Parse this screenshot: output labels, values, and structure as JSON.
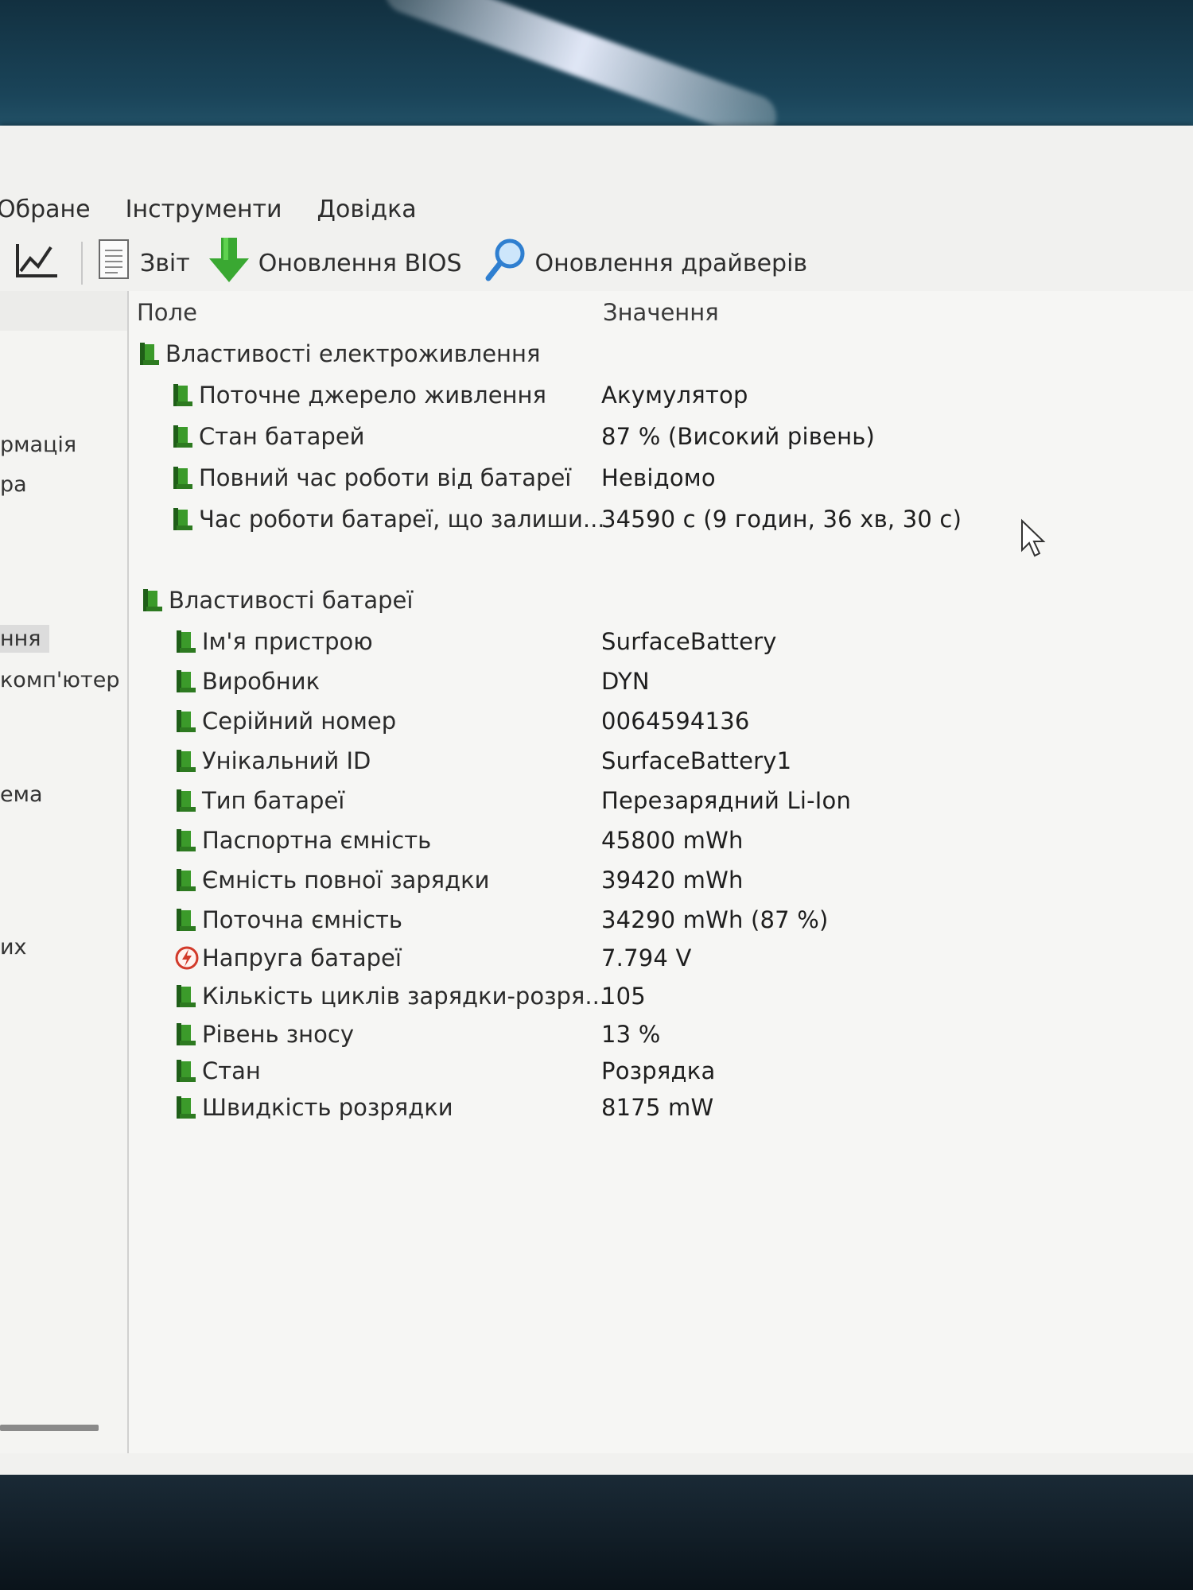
{
  "menu": {
    "items": [
      "Обране",
      "Інструменти",
      "Довідка"
    ]
  },
  "toolbar": {
    "report_label": "Звіт",
    "bios_label": "Оновлення BIOS",
    "drivers_label": "Оновлення драйверів"
  },
  "nav": {
    "items": [
      "рмація",
      "ра",
      "ння",
      "комп'ютер",
      "ема",
      "их"
    ]
  },
  "columns": {
    "field": "Поле",
    "value": "Значення"
  },
  "power_group": {
    "title": "Властивості електроживлення",
    "rows": [
      {
        "field": "Поточне джерело живлення",
        "value": "Акумулятор"
      },
      {
        "field": "Стан батарей",
        "value": "87 % (Високий рівень)"
      },
      {
        "field": "Повний час роботи від батареї",
        "value": "Невідомо"
      },
      {
        "field": "Час роботи батареї, що залиши...",
        "value": "34590 с (9 годин, 36 хв, 30 с)"
      }
    ]
  },
  "battery_group": {
    "title": "Властивості батареї",
    "rows": [
      {
        "field": "Ім'я пристрою",
        "value": "SurfaceBattery"
      },
      {
        "field": "Виробник",
        "value": "DYN"
      },
      {
        "field": "Серійний номер",
        "value": "0064594136"
      },
      {
        "field": "Унікальний ID",
        "value": "SurfaceBattery1"
      },
      {
        "field": "Тип батареї",
        "value": "Перезарядний Li-Ion"
      },
      {
        "field": "Паспортна ємність",
        "value": "45800 mWh"
      },
      {
        "field": "Ємність повної зарядки",
        "value": "39420 mWh"
      },
      {
        "field": "Поточна ємність",
        "value": "34290 mWh  (87 %)"
      },
      {
        "field": "Напруга батареї",
        "value": "7.794 V"
      },
      {
        "field": "Кількість циклів зарядки-розря...",
        "value": "105"
      },
      {
        "field": "Рівень зносу",
        "value": "13 %"
      },
      {
        "field": "Стан",
        "value": "Розрядка"
      },
      {
        "field": "Швидкість розрядки",
        "value": "8175 mW"
      }
    ]
  },
  "icons": {
    "battery": "battery-icon",
    "voltage": "voltage-icon",
    "chart": "chart-icon",
    "report": "report-icon",
    "bios": "download-arrow-icon",
    "drivers": "search-icon",
    "cursor": "mouse-cursor-icon"
  },
  "colors": {
    "battery_green": "#3b9a2a",
    "battery_dark": "#1f5e18",
    "voltage_red": "#d23a2a",
    "driver_blue": "#2f7fd0"
  }
}
